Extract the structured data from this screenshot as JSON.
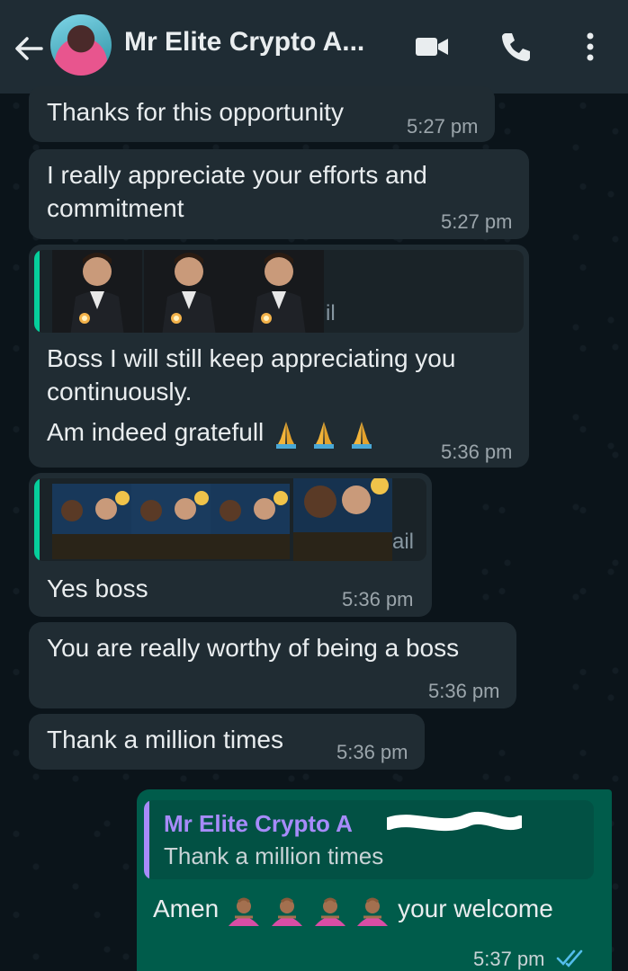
{
  "header": {
    "contact_name": "Mr Elite Crypto A...",
    "icons": [
      "back-arrow-icon",
      "video-call-icon",
      "voice-call-icon",
      "more-options-icon"
    ]
  },
  "messages": [
    {
      "text": "Thanks for this opportunity",
      "time": "5:27 pm"
    },
    {
      "line1": "I really appreciate your efforts and",
      "line2": "commitment",
      "time": "5:27 pm"
    },
    {
      "quote_suffix": "il",
      "line1": "Boss I will still keep appreciating you",
      "line2": "continuously.",
      "line3": "Am indeed gratefull",
      "emoji": "folded-hands",
      "time": "5:36 pm"
    },
    {
      "quote_suffix": "ail",
      "text": "Yes boss",
      "time": "5:36 pm"
    },
    {
      "text": "You are really worthy of being a boss",
      "time": "5:36 pm"
    },
    {
      "text": "Thank a million times",
      "time": "5:36 pm"
    }
  ],
  "outgoing": {
    "quoted_name": "Mr Elite Crypto A",
    "quoted_text": "Thank a million times",
    "prefix": "Amen",
    "suffix": "your welcome",
    "emoji": "person-bowing",
    "time": "5:37 pm",
    "status": "read"
  },
  "colors": {
    "header_bg": "#1f2c34",
    "incoming_bg": "#202c33",
    "outgoing_bg": "#005c4b",
    "read_tick": "#53bdeb",
    "quote_bar_incoming": "#06cf9c",
    "quote_bar_outgoing": "#a78bfa"
  }
}
